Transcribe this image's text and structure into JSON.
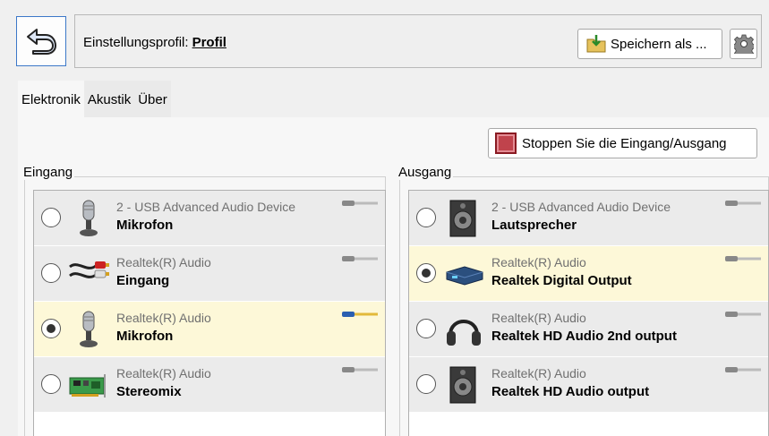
{
  "header": {
    "profile_label": "Einstellungsprofil:",
    "profile_name": "Profil",
    "save_label": "Speichern als ..."
  },
  "tabs": [
    {
      "label": "Elektronik",
      "active": true
    },
    {
      "label": "Akustik",
      "active": false
    },
    {
      "label": "Über",
      "active": false
    }
  ],
  "stop_button": "Stoppen Sie die Eingang/Ausgang",
  "input": {
    "title": "Eingang",
    "devices": [
      {
        "sub": "2 - USB Advanced Audio Device",
        "name": "Mikrofon",
        "icon": "microphone-icon",
        "selected": false
      },
      {
        "sub": "Realtek(R) Audio",
        "name": "Eingang",
        "icon": "rca-cable-icon",
        "selected": false
      },
      {
        "sub": "Realtek(R) Audio",
        "name": "Mikrofon",
        "icon": "microphone-icon",
        "selected": true
      },
      {
        "sub": "Realtek(R) Audio",
        "name": "Stereomix",
        "icon": "sound-card-icon",
        "selected": false
      }
    ]
  },
  "output": {
    "title": "Ausgang",
    "devices": [
      {
        "sub": "2 - USB Advanced Audio Device",
        "name": "Lautsprecher",
        "icon": "speaker-icon",
        "selected": false
      },
      {
        "sub": "Realtek(R) Audio",
        "name": "Realtek Digital Output",
        "icon": "digital-output-icon",
        "selected": true
      },
      {
        "sub": "Realtek(R) Audio",
        "name": "Realtek HD Audio 2nd output",
        "icon": "headphones-icon",
        "selected": false
      },
      {
        "sub": "Realtek(R) Audio",
        "name": "Realtek HD Audio output",
        "icon": "speaker-icon",
        "selected": false
      }
    ]
  },
  "colors": {
    "selected_row": "#fdf8d8",
    "row": "#ebebeb",
    "accent": "#3c78c8",
    "stop": "#c0434c"
  }
}
